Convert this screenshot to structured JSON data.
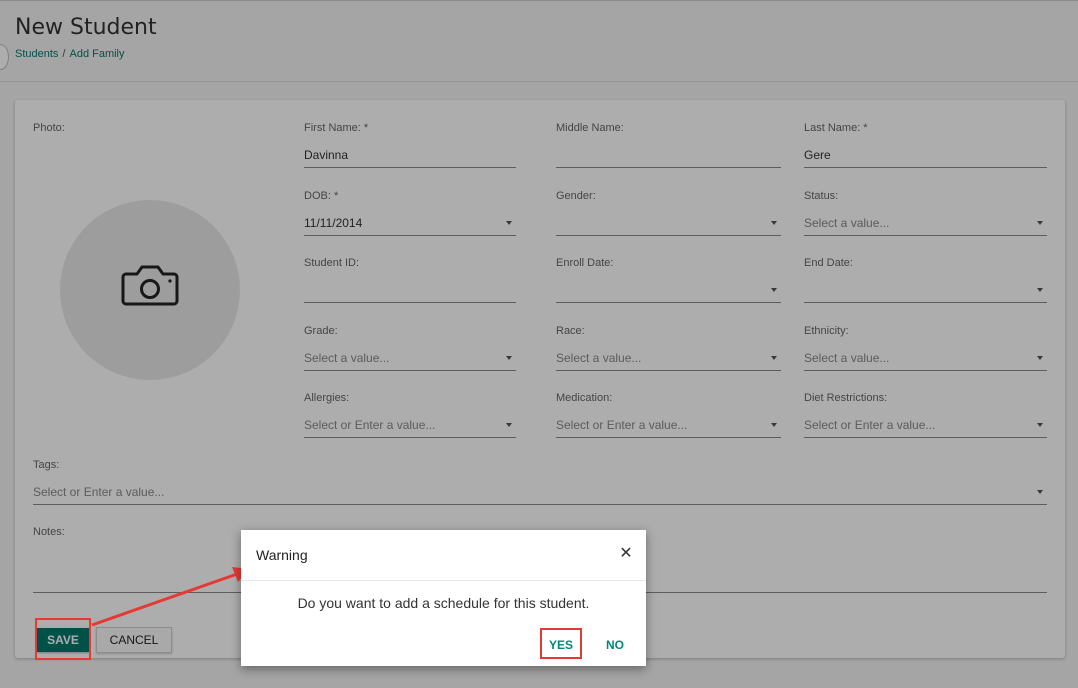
{
  "header": {
    "title": "New Student",
    "breadcrumb": [
      "Students",
      "Add Family"
    ]
  },
  "form": {
    "photo_label": "Photo:",
    "first_name": {
      "label": "First Name: *",
      "value": "Davinna"
    },
    "middle_name": {
      "label": "Middle Name:",
      "value": ""
    },
    "last_name": {
      "label": "Last Name: *",
      "value": "Gere"
    },
    "dob": {
      "label": "DOB: *",
      "value": "11/11/2014"
    },
    "gender": {
      "label": "Gender:",
      "value": ""
    },
    "status": {
      "label": "Status:",
      "placeholder": "Select a value..."
    },
    "student_id": {
      "label": "Student ID:",
      "value": ""
    },
    "enroll_date": {
      "label": "Enroll Date:",
      "value": ""
    },
    "end_date": {
      "label": "End Date:",
      "value": ""
    },
    "grade": {
      "label": "Grade:",
      "placeholder": "Select a value..."
    },
    "race": {
      "label": "Race:",
      "placeholder": "Select a value..."
    },
    "ethnicity": {
      "label": "Ethnicity:",
      "placeholder": "Select a value..."
    },
    "allergies": {
      "label": "Allergies:",
      "placeholder": "Select or Enter a value..."
    },
    "medication": {
      "label": "Medication:",
      "placeholder": "Select or Enter a value..."
    },
    "diet": {
      "label": "Diet Restrictions:",
      "placeholder": "Select or Enter a value..."
    },
    "tags": {
      "label": "Tags:",
      "placeholder": "Select or Enter a value..."
    },
    "notes": {
      "label": "Notes:",
      "value": ""
    }
  },
  "buttons": {
    "save": "SAVE",
    "cancel": "CANCEL"
  },
  "dialog": {
    "title": "Warning",
    "close_icon": "✕",
    "message": "Do you want to add a schedule for this student.",
    "yes": "YES",
    "no": "NO"
  },
  "colors": {
    "accent": "#00796b",
    "highlight": "#e53935"
  }
}
